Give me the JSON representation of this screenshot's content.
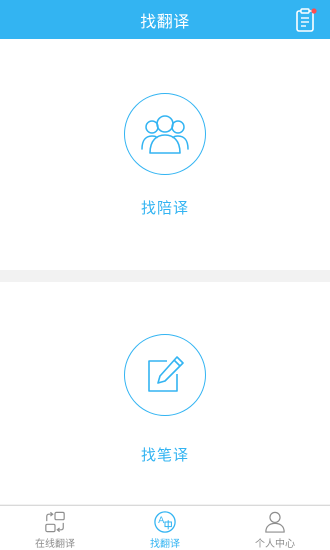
{
  "header": {
    "title": "找翻译",
    "action_icon": "clipboard-list-icon",
    "badge_color": "#ff4d4f"
  },
  "cards": {
    "interpretation": {
      "label": "找陪译",
      "icon": "group-people-icon"
    },
    "written": {
      "label": "找笔译",
      "icon": "edit-pencil-icon"
    }
  },
  "tabbar": {
    "tabs": [
      {
        "label": "在线翻译",
        "icon": "swap-translate-icon",
        "active": false
      },
      {
        "label": "找翻译",
        "icon": "a-zh-translate-icon",
        "active": true
      },
      {
        "label": "个人中心",
        "icon": "user-profile-icon",
        "active": false
      }
    ]
  },
  "colors": {
    "accent": "#33b4f2",
    "inactive": "#8e8e8e",
    "background": "#f2f2f2"
  }
}
